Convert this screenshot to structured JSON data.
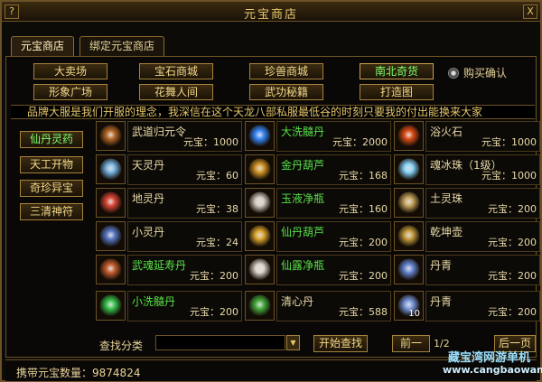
{
  "window": {
    "title": "元宝商店",
    "help_label": "?",
    "close_label": "X"
  },
  "tabs": [
    {
      "label": "元宝商店",
      "active": true
    },
    {
      "label": "绑定元宝商店",
      "active": false
    }
  ],
  "categories": [
    {
      "label": "大卖场",
      "active": false
    },
    {
      "label": "宝石商城",
      "active": false
    },
    {
      "label": "珍兽商城",
      "active": false
    },
    {
      "label": "南北奇货",
      "active": true
    },
    {
      "label": "形象广场",
      "active": false
    },
    {
      "label": "花舞人间",
      "active": false
    },
    {
      "label": "武功秘籍",
      "active": false
    },
    {
      "label": "打造图",
      "active": false
    }
  ],
  "confirm_radio": {
    "label": "购买确认"
  },
  "announcement": "品牌大服是我们开服的理念，我深信在这个天龙八部私服最低谷的时刻只要我的付出能换来大家",
  "sidebar": [
    {
      "label": "仙丹灵药",
      "active": true
    },
    {
      "label": "天工开物",
      "active": false
    },
    {
      "label": "奇珍异宝",
      "active": false
    },
    {
      "label": "三清神符",
      "active": false
    }
  ],
  "currency_label": "元宝：",
  "items": [
    {
      "name": "武道归元令",
      "price": "1000",
      "green": false,
      "icon": "brown-statue-icon",
      "color": "#b86a2a"
    },
    {
      "name": "大洗髓丹",
      "price": "2000",
      "green": true,
      "icon": "blue-orb-icon",
      "color": "#3a8cff"
    },
    {
      "name": "浴火石",
      "price": "1000",
      "green": false,
      "icon": "fire-stone-icon",
      "color": "#e0501a"
    },
    {
      "name": "天灵丹",
      "price": "60",
      "green": false,
      "icon": "blue-swirl-icon",
      "color": "#7ab8e8"
    },
    {
      "name": "金丹葫芦",
      "price": "168",
      "green": true,
      "icon": "gourd-icon",
      "color": "#d89a2a"
    },
    {
      "name": "魂冰珠（1级）",
      "price": "1000",
      "green": false,
      "icon": "crystal-ball-icon",
      "color": "#8ad8ff"
    },
    {
      "name": "地灵丹",
      "price": "38",
      "green": false,
      "icon": "red-swirl-icon",
      "color": "#e04a3a"
    },
    {
      "name": "玉液净瓶",
      "price": "160",
      "green": true,
      "icon": "vase-icon",
      "color": "#d8d0c8"
    },
    {
      "name": "土灵珠",
      "price": "200",
      "green": false,
      "icon": "earth-pearl-icon",
      "color": "#caa860"
    },
    {
      "name": "小灵丹",
      "price": "24",
      "green": false,
      "icon": "dark-swirl-icon",
      "color": "#5a7ac8"
    },
    {
      "name": "仙丹葫芦",
      "price": "200",
      "green": true,
      "icon": "gourd-icon",
      "color": "#e0a830"
    },
    {
      "name": "乾坤壶",
      "price": "200",
      "green": false,
      "icon": "teapot-icon",
      "color": "#c8a040"
    },
    {
      "name": "武魂延寿丹",
      "price": "200",
      "green": true,
      "icon": "pill-bowl-icon",
      "color": "#c86030"
    },
    {
      "name": "仙露净瓶",
      "price": "200",
      "green": true,
      "icon": "vase-icon",
      "color": "#e0d8d0"
    },
    {
      "name": "丹青",
      "price": "200",
      "green": false,
      "icon": "scroll-icon",
      "color": "#6a8ad8"
    },
    {
      "name": "小洗髓丹",
      "price": "200",
      "green": true,
      "icon": "green-box-icon",
      "color": "#3ac850"
    },
    {
      "name": "清心丹",
      "price": "588",
      "green": false,
      "icon": "green-box-icon",
      "color": "#48b040"
    },
    {
      "name": "丹青",
      "price": "200",
      "green": false,
      "icon": "scroll-icon",
      "color": "#7a9ae0",
      "qty": "10"
    }
  ],
  "search": {
    "label": "查找分类",
    "value": "",
    "button_label": "开始查找"
  },
  "pagination": {
    "prev_label": "前一",
    "page": "1/2",
    "next_label": "后一页"
  },
  "balance": {
    "label": "携带元宝数量：",
    "value": "9874824"
  },
  "watermark": {
    "line1": "藏宝湾网游单机",
    "line2": "www.cangbaowan.net"
  }
}
